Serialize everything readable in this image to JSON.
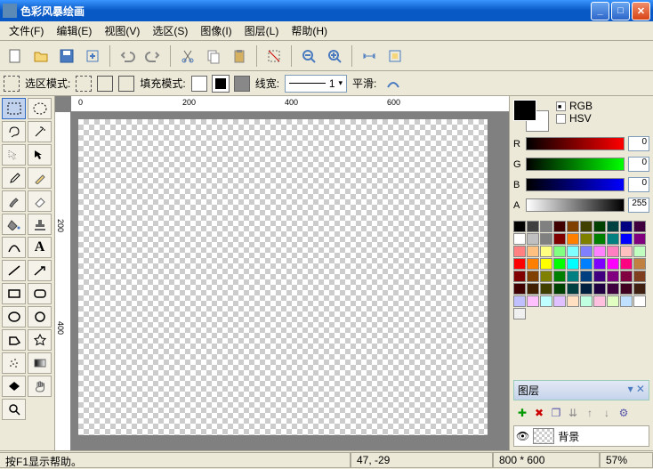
{
  "title": "色彩风暴绘画",
  "menu": {
    "file": "文件(F)",
    "edit": "编辑(E)",
    "view": "视图(V)",
    "select": "选区(S)",
    "image": "图像(I)",
    "layer": "图层(L)",
    "help": "帮助(H)"
  },
  "options": {
    "select_mode": "选区模式:",
    "fill_mode": "填充模式:",
    "line_width": "线宽:",
    "line_width_value": "1",
    "smooth": "平滑:"
  },
  "ruler": {
    "h": [
      "0",
      "200",
      "400",
      "600"
    ],
    "v": [
      "200",
      "400"
    ]
  },
  "color": {
    "rgb_label": "RGB",
    "hsv_label": "HSV",
    "r": "R",
    "g": "G",
    "b": "B",
    "a": "A",
    "r_val": "0",
    "g_val": "0",
    "b_val": "0",
    "a_val": "255"
  },
  "palette_colors": [
    "#000000",
    "#404040",
    "#808080",
    "#400000",
    "#804000",
    "#404000",
    "#004000",
    "#004040",
    "#000080",
    "#400040",
    "#ffffff",
    "#c0c0c0",
    "#808080",
    "#800000",
    "#ff8000",
    "#808000",
    "#008000",
    "#008080",
    "#0000ff",
    "#800080",
    "#ff8080",
    "#ffc080",
    "#ffff80",
    "#80ff80",
    "#80ffff",
    "#8080ff",
    "#ff80ff",
    "#ff80c0",
    "#ffc0c0",
    "#c0ffc0",
    "#ff0000",
    "#ff8000",
    "#ffff00",
    "#00ff00",
    "#00ffff",
    "#0080ff",
    "#8000ff",
    "#ff00ff",
    "#ff0080",
    "#c08040",
    "#800000",
    "#804000",
    "#808000",
    "#008000",
    "#008080",
    "#004080",
    "#400080",
    "#800080",
    "#800040",
    "#804020",
    "#400000",
    "#402000",
    "#404000",
    "#004000",
    "#004040",
    "#002040",
    "#200040",
    "#400040",
    "#400020",
    "#402010",
    "#c0c0ff",
    "#ffc0ff",
    "#c0ffff",
    "#e0c0ff",
    "#ffe0c0",
    "#c0ffe0",
    "#ffc0e0",
    "#e0ffc0",
    "#c0e0ff",
    "#ffffff",
    "#f0f0f0"
  ],
  "layers": {
    "title": "图层",
    "default_name": "背景"
  },
  "status": {
    "help": "按F1显示帮助。",
    "coords": "47, -29",
    "dims": "800 * 600",
    "zoom": "57%"
  }
}
